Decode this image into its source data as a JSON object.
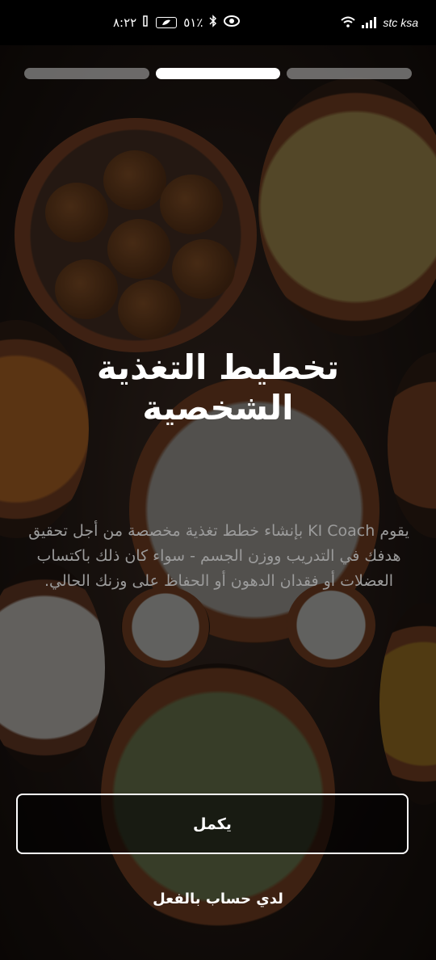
{
  "status_bar": {
    "time": "٨:٢٢",
    "battery": "٥١٪",
    "carrier": "stc ksa"
  },
  "onboarding": {
    "pages_total": 3,
    "current_page": 2,
    "title": "تخطيط التغذية الشخصية",
    "description": "يقوم KI Coach بإنشاء خطط تغذية مخصصة من أجل تحقيق هدفك في التدريب ووزن الجسم - سواء كان ذلك باكتساب العضلات أو فقدان الدهون أو الحفاظ على وزنك الحالي.",
    "continue_label": "يكمل",
    "have_account_label": "لدي حساب بالفعل"
  },
  "icons": [
    "nfc-icon",
    "bluetooth-icon",
    "eye-icon",
    "battery-icon",
    "wifi-icon",
    "signal-icon"
  ]
}
